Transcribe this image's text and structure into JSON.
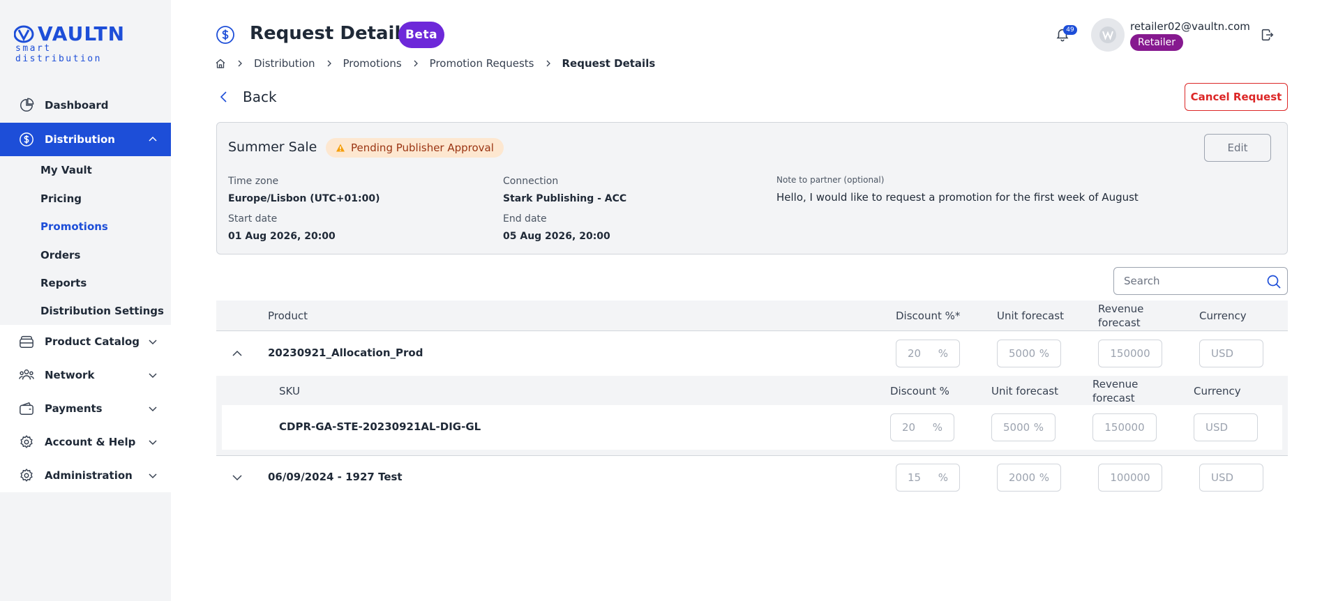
{
  "brand": {
    "logo_word": "VAULTN",
    "logo_sub": "smart distribution"
  },
  "sidebar": {
    "items": [
      {
        "label": "Dashboard",
        "icon": "pie-chart-icon"
      },
      {
        "label": "Distribution",
        "icon": "dollar-circle-icon",
        "active": true,
        "expanded": true
      },
      {
        "label": "Product Catalog",
        "icon": "catalog-icon"
      },
      {
        "label": "Network",
        "icon": "network-icon"
      },
      {
        "label": "Payments",
        "icon": "wallet-icon"
      },
      {
        "label": "Account & Help",
        "icon": "gear-icon"
      },
      {
        "label": "Administration",
        "icon": "gear-icon"
      }
    ],
    "sub_items": [
      {
        "label": "My Vault"
      },
      {
        "label": "Pricing"
      },
      {
        "label": "Promotions",
        "active": true
      },
      {
        "label": "Orders"
      },
      {
        "label": "Reports"
      },
      {
        "label": "Distribution Settings"
      }
    ]
  },
  "header": {
    "title": "Request Details",
    "beta_label": "Beta",
    "notification_count": "49",
    "user_email": "retailer02@vaultn.com",
    "role": "Retailer",
    "avatar_initial": "W"
  },
  "breadcrumb": [
    "Distribution",
    "Promotions",
    "Promotion Requests",
    "Request Details"
  ],
  "back_label": "Back",
  "cancel_label": "Cancel Request",
  "summary": {
    "title": "Summer Sale",
    "status": "Pending Publisher Approval",
    "edit_label": "Edit",
    "timezone_label": "Time zone",
    "timezone_value": "Europe/Lisbon (UTC+01:00)",
    "connection_label": "Connection",
    "connection_value": "Stark Publishing - ACC",
    "note_label": "Note to partner (optional)",
    "note_value": "Hello, I would like to request a promotion for the first week of August",
    "start_label": "Start date",
    "start_value": "01 Aug 2026, 20:00",
    "end_label": "End date",
    "end_value": "05 Aug 2026, 20:00"
  },
  "search": {
    "placeholder": "Search"
  },
  "table": {
    "headers": {
      "product": "Product",
      "discount": "Discount %*",
      "unit_forecast": "Unit forecast",
      "revenue_line1": "Revenue",
      "revenue_line2": "forecast",
      "currency": "Currency"
    },
    "sub_headers": {
      "sku": "SKU",
      "discount": "Discount %",
      "unit_forecast": "Unit forecast",
      "revenue_line1": "Revenue",
      "revenue_line2": "forecast",
      "currency": "Currency"
    },
    "unit_symbol": "%",
    "rows": [
      {
        "name": "20230921_Allocation_Prod",
        "expanded": true,
        "discount": "20",
        "unit_forecast": "5000",
        "revenue_forecast": "150000",
        "currency": "USD",
        "skus": [
          {
            "sku": "CDPR-GA-STE-20230921AL-DIG-GL",
            "discount": "20",
            "unit_forecast": "5000",
            "revenue_forecast": "150000",
            "currency": "USD"
          }
        ]
      },
      {
        "name": "06/09/2024 - 1927 Test",
        "expanded": false,
        "discount": "15",
        "unit_forecast": "2000",
        "revenue_forecast": "100000",
        "currency": "USD"
      }
    ]
  },
  "colors": {
    "primary": "#1d4ed8",
    "beta": "#6d28d9",
    "role": "#86198f",
    "danger": "#dc2626",
    "warning_bg": "#fde7d0"
  }
}
